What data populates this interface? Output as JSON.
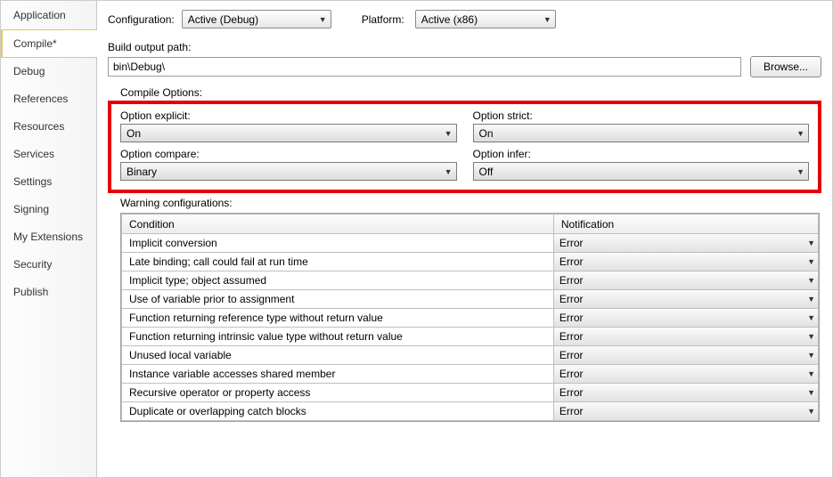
{
  "sidebar": {
    "items": [
      {
        "label": "Application"
      },
      {
        "label": "Compile*"
      },
      {
        "label": "Debug"
      },
      {
        "label": "References"
      },
      {
        "label": "Resources"
      },
      {
        "label": "Services"
      },
      {
        "label": "Settings"
      },
      {
        "label": "Signing"
      },
      {
        "label": "My Extensions"
      },
      {
        "label": "Security"
      },
      {
        "label": "Publish"
      }
    ],
    "selected_index": 1
  },
  "top": {
    "config_label": "Configuration:",
    "config_value": "Active (Debug)",
    "platform_label": "Platform:",
    "platform_value": "Active (x86)"
  },
  "build_output": {
    "label": "Build output path:",
    "value": "bin\\Debug\\",
    "browse_label": "Browse..."
  },
  "compile_options": {
    "legend": "Compile Options:",
    "explicit_label": "Option explicit:",
    "explicit_value": "On",
    "strict_label": "Option strict:",
    "strict_value": "On",
    "compare_label": "Option compare:",
    "compare_value": "Binary",
    "infer_label": "Option infer:",
    "infer_value": "Off"
  },
  "warnings": {
    "legend": "Warning configurations:",
    "col_condition": "Condition",
    "col_notification": "Notification",
    "rows": [
      {
        "condition": "Implicit conversion",
        "notification": "Error"
      },
      {
        "condition": "Late binding; call could fail at run time",
        "notification": "Error"
      },
      {
        "condition": "Implicit type; object assumed",
        "notification": "Error"
      },
      {
        "condition": "Use of variable prior to assignment",
        "notification": "Error"
      },
      {
        "condition": "Function returning reference type without return value",
        "notification": "Error"
      },
      {
        "condition": "Function returning intrinsic value type without return value",
        "notification": "Error"
      },
      {
        "condition": "Unused local variable",
        "notification": "Error"
      },
      {
        "condition": "Instance variable accesses shared member",
        "notification": "Error"
      },
      {
        "condition": "Recursive operator or property access",
        "notification": "Error"
      },
      {
        "condition": "Duplicate or overlapping catch blocks",
        "notification": "Error"
      }
    ]
  }
}
